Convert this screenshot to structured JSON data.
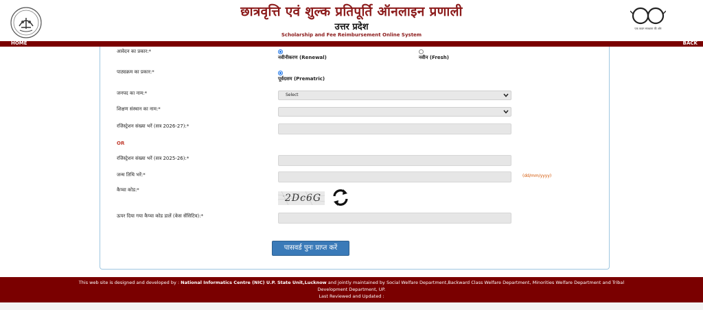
{
  "header": {
    "title_hi": "छात्रवृत्ति एवं शुल्क प्रतिपूर्ति ऑनलाइन प्रणाली",
    "subtitle_hi": "उत्तर प्रदेश",
    "subtitle_en": "Scholarship and Fee Reimbursement Online System",
    "logo_right_caption": "एक कदम स्वच्छता की ओर"
  },
  "nav": {
    "home": "HOME",
    "back": "BACK"
  },
  "form": {
    "application_type_label": "आवेदन का प्रकार:*",
    "application_type_options": [
      {
        "label": "नवीनीकरण (Renewal)",
        "checked": true
      },
      {
        "label": "नवीन (Fresh)",
        "checked": false
      }
    ],
    "course_type_label": "पाठ्यक्रम का प्रकार:*",
    "course_type_option": {
      "label": "पूर्वदशम (Prematric)",
      "checked": true
    },
    "district_label": "जनपद का नाम:*",
    "district_value": "Select",
    "institution_label": "शिक्षण संस्थान का नाम:*",
    "institution_value": "",
    "reg_new_label": "रजिस्ट्रेशन संख्या भरें (सत्र 2026-27):*",
    "or_text": "OR",
    "reg_old_label": "रजिस्ट्रेशन संख्या भरें (सत्र 2025-26):*",
    "dob_label": "जन्म तिथि भरें:*",
    "dob_hint": "(dd/mm/yyyy)",
    "captcha_label": "कैप्चा कोड:*",
    "captcha_text": "2Dc6G",
    "captcha_input_label": "ऊपर दिया गया कैप्चा कोड डालें (केस सेंसिटिव):*",
    "submit_label": "पासवर्ड पुनः प्राप्त करें"
  },
  "footer": {
    "line1_prefix": "This web site is designed and developed by : ",
    "line1_bold": "National Informatics Centre (NIC) U.P. State Unit,Lucknow",
    "line1_suffix": " and jointly maintained by Social Welfare Department,Backward Class Welfare Department, Minorities Welfare Department and Tribal",
    "line2": "Development Department, UP.",
    "line3": "Last Reviewed and Updated :"
  },
  "colors": {
    "brand_maroon": "#7a0000",
    "title_red": "#8b1a1a",
    "button_blue": "#3a7ab8",
    "panel_border": "#9ec6e0"
  }
}
